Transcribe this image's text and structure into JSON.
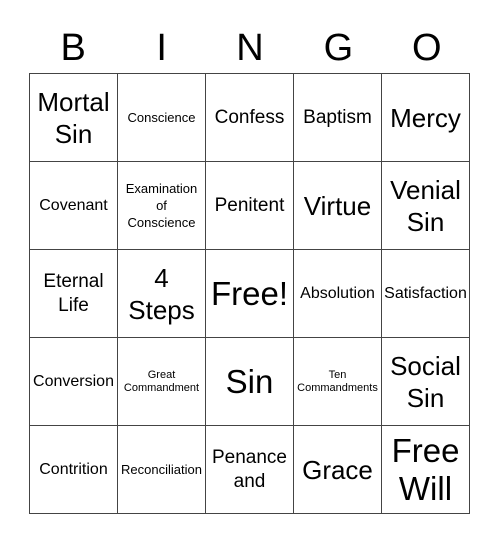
{
  "header": [
    "B",
    "I",
    "N",
    "G",
    "O"
  ],
  "cells": [
    {
      "text": "Mortal\nSin",
      "size": "s-lg"
    },
    {
      "text": "Conscience",
      "size": "s-xs"
    },
    {
      "text": "Confess",
      "size": "s-md"
    },
    {
      "text": "Baptism",
      "size": "s-md"
    },
    {
      "text": "Mercy",
      "size": "s-lg"
    },
    {
      "text": "Covenant",
      "size": "s-sm"
    },
    {
      "text": "Examination\nof\nConscience",
      "size": "s-xs"
    },
    {
      "text": "Penitent",
      "size": "s-md"
    },
    {
      "text": "Virtue",
      "size": "s-lg"
    },
    {
      "text": "Venial\nSin",
      "size": "s-lg"
    },
    {
      "text": "Eternal\nLife",
      "size": "s-md"
    },
    {
      "text": "4\nSteps",
      "size": "s-lg"
    },
    {
      "text": "Free!",
      "size": "s-xl"
    },
    {
      "text": "Absolution",
      "size": "s-sm"
    },
    {
      "text": "Satisfaction",
      "size": "s-sm"
    },
    {
      "text": "Conversion",
      "size": "s-sm"
    },
    {
      "text": "Great\nCommandment",
      "size": "s-xxs"
    },
    {
      "text": "Sin",
      "size": "s-xl"
    },
    {
      "text": "Ten\nCommandments",
      "size": "s-xxs"
    },
    {
      "text": "Social\nSin",
      "size": "s-lg"
    },
    {
      "text": "Contrition",
      "size": "s-sm"
    },
    {
      "text": "Reconciliation",
      "size": "s-xs"
    },
    {
      "text": "Penance\nand",
      "size": "s-md"
    },
    {
      "text": "Grace",
      "size": "s-lg"
    },
    {
      "text": "Free\nWill",
      "size": "s-xl"
    }
  ]
}
